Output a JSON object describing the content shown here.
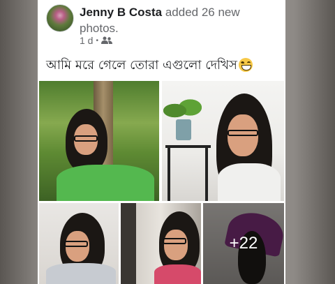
{
  "post": {
    "author": "Jenny B Costa",
    "action": "added 26 new photos.",
    "time": "1 d",
    "separator": "•",
    "audience_icon": "friends-icon",
    "text": "আমি মরে গেলে তোরা এগুলো দেখিস",
    "text_emoji": "grinning-face-emoji"
  },
  "photos": {
    "more_count": "+22"
  }
}
